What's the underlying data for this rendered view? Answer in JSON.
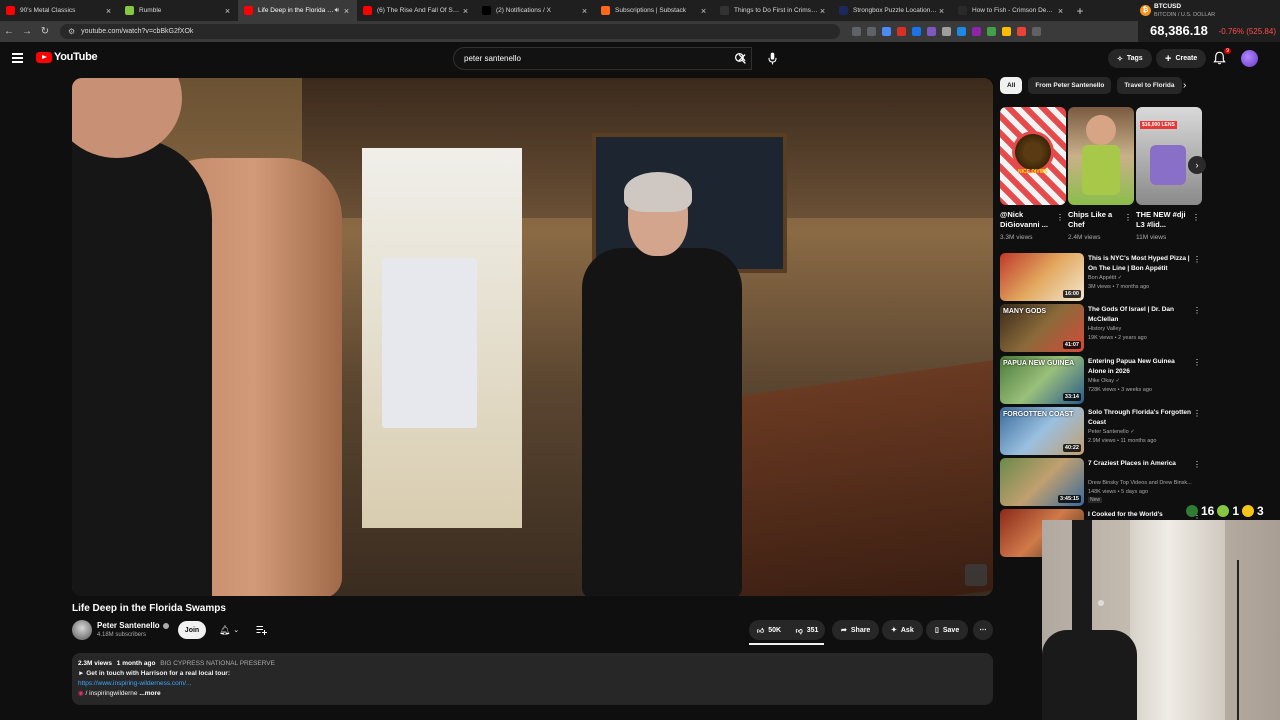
{
  "browser": {
    "tabs": [
      {
        "title": "90's Metal Classics",
        "color": "#ff0000",
        "active": false,
        "closable": true
      },
      {
        "title": "Rumble",
        "color": "#85c742",
        "active": false,
        "closable": true
      },
      {
        "title": "Life Deep in the Florida Swa",
        "color": "#ff0000",
        "active": true,
        "closable": true,
        "audio": true
      },
      {
        "title": "(6) The Rise And Fall Of Southe",
        "color": "#ff0000",
        "active": false,
        "closable": true
      },
      {
        "title": "(2) Notifications / X",
        "color": "#000000",
        "active": false,
        "closable": true
      },
      {
        "title": "Subscriptions | Substack",
        "color": "#ff6719",
        "active": false,
        "closable": true
      },
      {
        "title": "Things to Do First in Crimson D",
        "color": "#333333",
        "active": false,
        "closable": true
      },
      {
        "title": "Strongbox Puzzle Locations an",
        "color": "#1a2a5a",
        "active": false,
        "closable": true
      },
      {
        "title": "How to Fish - Crimson Desert G",
        "color": "#2a2a2a",
        "active": false,
        "closable": true
      }
    ],
    "new_tab": "+",
    "url": "youtube.com/watch?v=cbBkG2fXOk",
    "ticker": {
      "symbol": "BTCUSD",
      "subtitle": "BITCOIN / U.S. DOLLAR",
      "price": "68,386.18",
      "change": "-0.76% (525.84)"
    }
  },
  "youtube": {
    "logo": "YouTube",
    "search_value": "peter santenello",
    "tags_label": "Tags",
    "create_label": "Create",
    "notif_count": "9"
  },
  "video": {
    "title": "Life Deep in the Florida Swamps",
    "channel": "Peter Santenello",
    "subscribers": "4.18M subscribers",
    "join_label": "Join",
    "likes": "50K",
    "dislikes": "351",
    "share_label": "Share",
    "ask_label": "Ask",
    "save_label": "Save",
    "description": {
      "views": "2.3M views",
      "date": "1 month ago",
      "tag": "BIG CYPRESS NATIONAL PRESERVE",
      "line1": "► Get in touch with Harrison for a real local tour:",
      "link": "https://www.inspiring-wilderness.com/...",
      "line3": "/ inspiringwilderne",
      "more": "...more"
    }
  },
  "sidebar": {
    "chips": [
      "All",
      "From Peter Santenello",
      "Travel to Florida"
    ],
    "shorts": [
      {
        "title": "@Nick DiGiovanni ...",
        "views": "3.3M views",
        "caption": "NICE DIVIDE"
      },
      {
        "title": "Chips Like a Chef",
        "views": "2.4M views",
        "caption": ""
      },
      {
        "title": "THE NEW #dji L3 #lid...",
        "views": "11M views",
        "caption": "$16,000 LENS"
      }
    ],
    "recommendations": [
      {
        "title": "This is NYC's Most Hyped Pizza | On The Line | Bon Appétit",
        "channel": "Bon Appétit",
        "meta": "3M views • 7 months ago",
        "duration": "16:00",
        "badge": "",
        "thumb_text": "",
        "verified": true
      },
      {
        "title": "The Gods Of Israel | Dr. Dan McClellan",
        "channel": "History Valley",
        "meta": "19K views • 2 years ago",
        "duration": "41:07",
        "badge": "",
        "thumb_text": "MANY GODS",
        "verified": false
      },
      {
        "title": "Entering Papua New Guinea Alone in 2026",
        "channel": "Mike Okay",
        "meta": "728K views • 3 weeks ago",
        "duration": "33:14",
        "badge": "",
        "thumb_text": "PAPUA NEW GUINEA",
        "verified": true
      },
      {
        "title": "Solo Through Florida's Forgotten Coast",
        "channel": "Peter Santenello",
        "meta": "2.9M views • 11 months ago",
        "duration": "40:22",
        "badge": "",
        "thumb_text": "FORGOTTEN COAST",
        "verified": true
      },
      {
        "title": "7 Craziest Places in America",
        "channel": "Drew Binsky Top Videos and Drew Binsk...",
        "meta": "148K views • 5 days ago",
        "duration": "3:45:15",
        "badge": "New",
        "thumb_text": "",
        "verified": false
      },
      {
        "title": "I Cooked for the World's",
        "channel": "",
        "meta": "",
        "duration": "",
        "badge": "",
        "thumb_text": "",
        "verified": false
      }
    ]
  },
  "overlay": {
    "count1": "16",
    "count2": "1",
    "count3": "3"
  }
}
